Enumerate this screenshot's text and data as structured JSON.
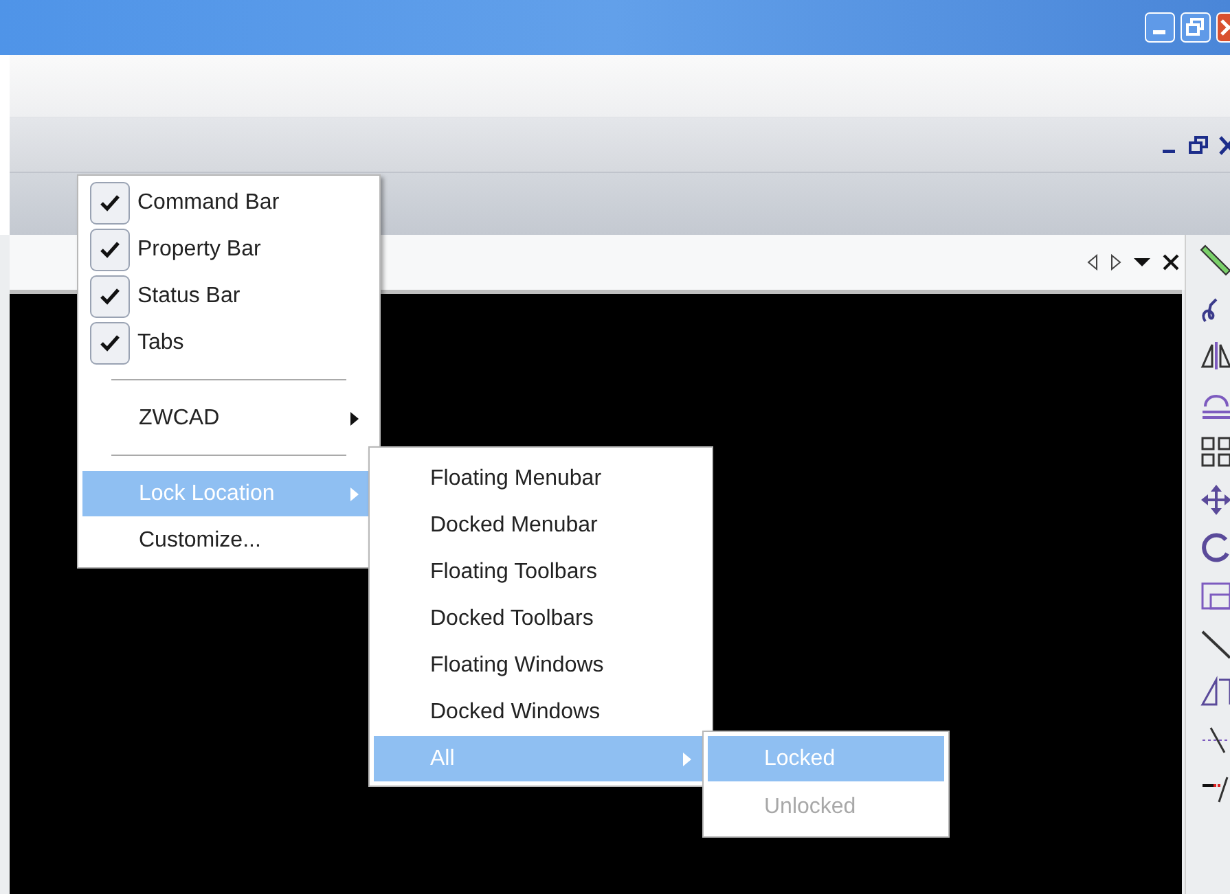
{
  "main_menu": {
    "items": [
      {
        "kind": "check",
        "label": "Command Bar",
        "checked": true,
        "selected": false
      },
      {
        "kind": "check",
        "label": "Property Bar",
        "checked": true,
        "selected": false
      },
      {
        "kind": "check",
        "label": "Status Bar",
        "checked": true,
        "selected": false
      },
      {
        "kind": "check",
        "label": "Tabs",
        "checked": true,
        "selected": false
      },
      {
        "kind": "separator"
      },
      {
        "kind": "submenu",
        "label": "ZWCAD",
        "selected": false
      },
      {
        "kind": "separator"
      },
      {
        "kind": "submenu",
        "label": "Lock Location",
        "selected": true
      },
      {
        "kind": "plain",
        "label": "Customize...",
        "selected": false
      }
    ]
  },
  "lock_menu": {
    "items": [
      {
        "kind": "plain",
        "label": "Floating Menubar",
        "selected": false
      },
      {
        "kind": "plain",
        "label": "Docked Menubar",
        "selected": false
      },
      {
        "kind": "plain",
        "label": "Floating Toolbars",
        "selected": false
      },
      {
        "kind": "plain",
        "label": "Docked Toolbars",
        "selected": false
      },
      {
        "kind": "plain",
        "label": "Floating Windows",
        "selected": false
      },
      {
        "kind": "plain",
        "label": "Docked Windows",
        "selected": false
      },
      {
        "kind": "submenu",
        "label": "All",
        "selected": true
      }
    ]
  },
  "all_menu": {
    "items": [
      {
        "label": "Locked",
        "selected": true,
        "disabled": false
      },
      {
        "label": "Unlocked",
        "selected": false,
        "disabled": true
      }
    ]
  }
}
